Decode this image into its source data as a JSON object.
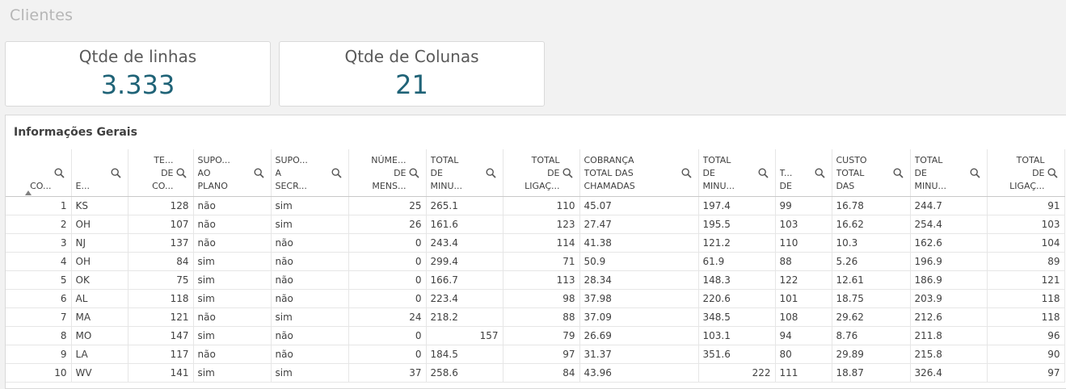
{
  "sheet": {
    "title": "Clientes"
  },
  "kpis": [
    {
      "label": "Qtde de linhas",
      "value": "3.333"
    },
    {
      "label": "Qtde de Colunas",
      "value": "21"
    }
  ],
  "table": {
    "title": "Informações Gerais",
    "columns": [
      {
        "label": "CO...",
        "align": "r",
        "width": 81
      },
      {
        "label": "E...",
        "align": "l",
        "width": 70
      },
      {
        "label": "TE...\n     DE\nCO...",
        "align": "r",
        "width": 81
      },
      {
        "label": "SUPO...\nAO\nPLANO",
        "align": "l",
        "width": 96
      },
      {
        "label": "SUPO...\nA\nSECR...",
        "align": "l",
        "width": 96
      },
      {
        "label": "NÚME...\n      DE\nMENS...",
        "align": "r",
        "width": 96
      },
      {
        "label": "TOTAL\nDE\nMINU...",
        "align": "l",
        "width": 95
      },
      {
        "label": "TOTAL\n     DE\nLIGAÇ...",
        "align": "r",
        "width": 95
      },
      {
        "label": "COBRANÇA\nTOTAL DAS\nCHAMADAS",
        "align": "l",
        "width": 147
      },
      {
        "label": "TOTAL\nDE\nMINU...",
        "align": "l",
        "width": 95
      },
      {
        "label": "T...\nDE",
        "align": "l",
        "width": 70
      },
      {
        "label": "CUSTO\nTOTAL\nDAS",
        "align": "l",
        "width": 97
      },
      {
        "label": "TOTAL\nDE\nMINU...",
        "align": "l",
        "width": 95
      },
      {
        "label": "TOTAL\n     DE\nLIGAÇ...",
        "align": "r",
        "width": 96
      }
    ],
    "rows": [
      [
        "1",
        "KS",
        "128",
        "não",
        "sim",
        "25",
        "265.1",
        "110",
        "45.07",
        "197.4",
        "99",
        "16.78",
        "244.7",
        "91"
      ],
      [
        "2",
        "OH",
        "107",
        "não",
        "sim",
        "26",
        "161.6",
        "123",
        "27.47",
        "195.5",
        "103",
        "16.62",
        "254.4",
        "103"
      ],
      [
        "3",
        "NJ",
        "137",
        "não",
        "não",
        "0",
        "243.4",
        "114",
        "41.38",
        "121.2",
        "110",
        "10.3",
        "162.6",
        "104"
      ],
      [
        "4",
        "OH",
        "84",
        "sim",
        "não",
        "0",
        "299.4",
        "71",
        "50.9",
        "61.9",
        "88",
        "5.26",
        "196.9",
        "89"
      ],
      [
        "5",
        "OK",
        "75",
        "sim",
        "não",
        "0",
        "166.7",
        "113",
        "28.34",
        "148.3",
        "122",
        "12.61",
        "186.9",
        "121"
      ],
      [
        "6",
        "AL",
        "118",
        "sim",
        "não",
        "0",
        "223.4",
        "98",
        "37.98",
        "220.6",
        "101",
        "18.75",
        "203.9",
        "118"
      ],
      [
        "7",
        "MA",
        "121",
        "não",
        "sim",
        "24",
        "218.2",
        "88",
        "37.09",
        "348.5",
        "108",
        "29.62",
        "212.6",
        "118"
      ],
      [
        "8",
        "MO",
        "147",
        "sim",
        "não",
        "0",
        "157",
        "79",
        "26.69",
        "103.1",
        "94",
        "8.76",
        "211.8",
        "96"
      ],
      [
        "9",
        "LA",
        "117",
        "não",
        "não",
        "0",
        "184.5",
        "97",
        "31.37",
        "351.6",
        "80",
        "29.89",
        "215.8",
        "90"
      ],
      [
        "10",
        "WV",
        "141",
        "sim",
        "sim",
        "37",
        "258.6",
        "84",
        "43.96",
        "222",
        "111",
        "18.87",
        "326.4",
        "97"
      ]
    ],
    "number_right_columns": [
      6,
      9
    ]
  }
}
